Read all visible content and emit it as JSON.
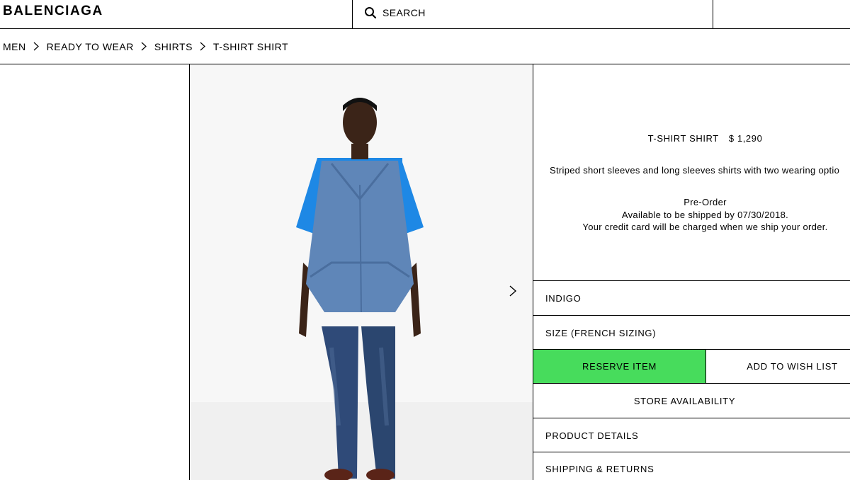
{
  "header": {
    "brand": "BALENCIAGA",
    "search_label": "SEARCH"
  },
  "breadcrumb": [
    "MEN",
    "READY TO WEAR",
    "SHIRTS",
    "T-SHIRT SHIRT"
  ],
  "product": {
    "name": "T-SHIRT SHIRT",
    "price": "$ 1,290",
    "description": "Striped short sleeves and long sleeves shirts with two wearing optio",
    "preorder_title": "Pre-Order",
    "preorder_ship": "Available to be shipped by 07/30/2018.",
    "preorder_charge": "Your credit card will be charged when we ship your order."
  },
  "options": {
    "color": "INDIGO",
    "size": "SIZE (FRENCH SIZING)"
  },
  "actions": {
    "reserve": "RESERVE ITEM",
    "wishlist": "ADD TO WISH LIST",
    "store": "STORE AVAILABILITY"
  },
  "accordion": {
    "product_details": "PRODUCT DETAILS",
    "shipping": "SHIPPING & RETURNS"
  },
  "colors": {
    "reserve_green": "#47dc5c",
    "shirt_blue": "#1e88e5",
    "denim": "#2f4a78"
  },
  "icons": {
    "search": "search-icon",
    "chevron": "chevron-right-icon",
    "next": "next-image-icon"
  }
}
